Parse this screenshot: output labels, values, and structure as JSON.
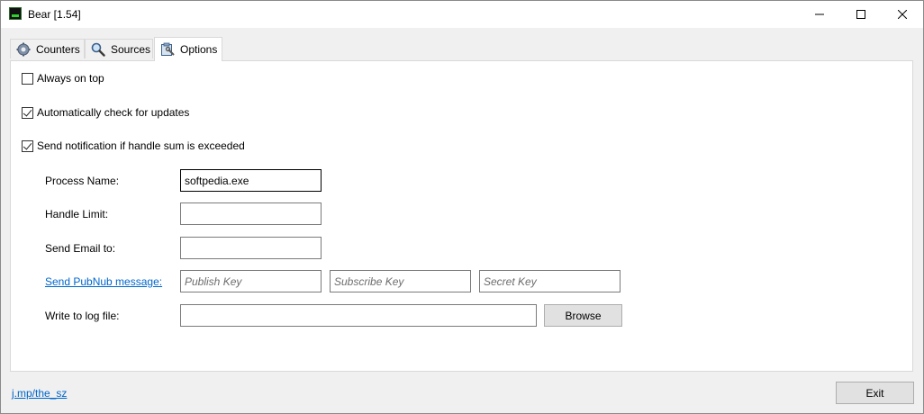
{
  "window": {
    "title": "Bear [1.54]"
  },
  "tabs": [
    {
      "label": "Counters",
      "icon": "gear-icon"
    },
    {
      "label": "Sources",
      "icon": "magnifier-icon"
    },
    {
      "label": "Options",
      "icon": "options-icon",
      "active": true
    }
  ],
  "options": {
    "always_on_top": {
      "label": "Always on top",
      "checked": false
    },
    "auto_update": {
      "label": "Automatically check for updates",
      "checked": true
    },
    "send_notification": {
      "label": "Send notification if handle sum is exceeded",
      "checked": true
    },
    "process_name": {
      "label": "Process Name:",
      "value": "softpedia.exe"
    },
    "handle_limit": {
      "label": "Handle Limit:",
      "value": ""
    },
    "send_email": {
      "label": "Send Email to:",
      "value": ""
    },
    "pubnub": {
      "label": "Send PubNub message:",
      "publish_placeholder": "Publish Key",
      "subscribe_placeholder": "Subscribe Key",
      "secret_placeholder": "Secret Key"
    },
    "log_file": {
      "label": "Write to log file:",
      "value": "",
      "browse_label": "Browse"
    }
  },
  "footer": {
    "link": "j.mp/the_sz",
    "exit_label": "Exit"
  }
}
